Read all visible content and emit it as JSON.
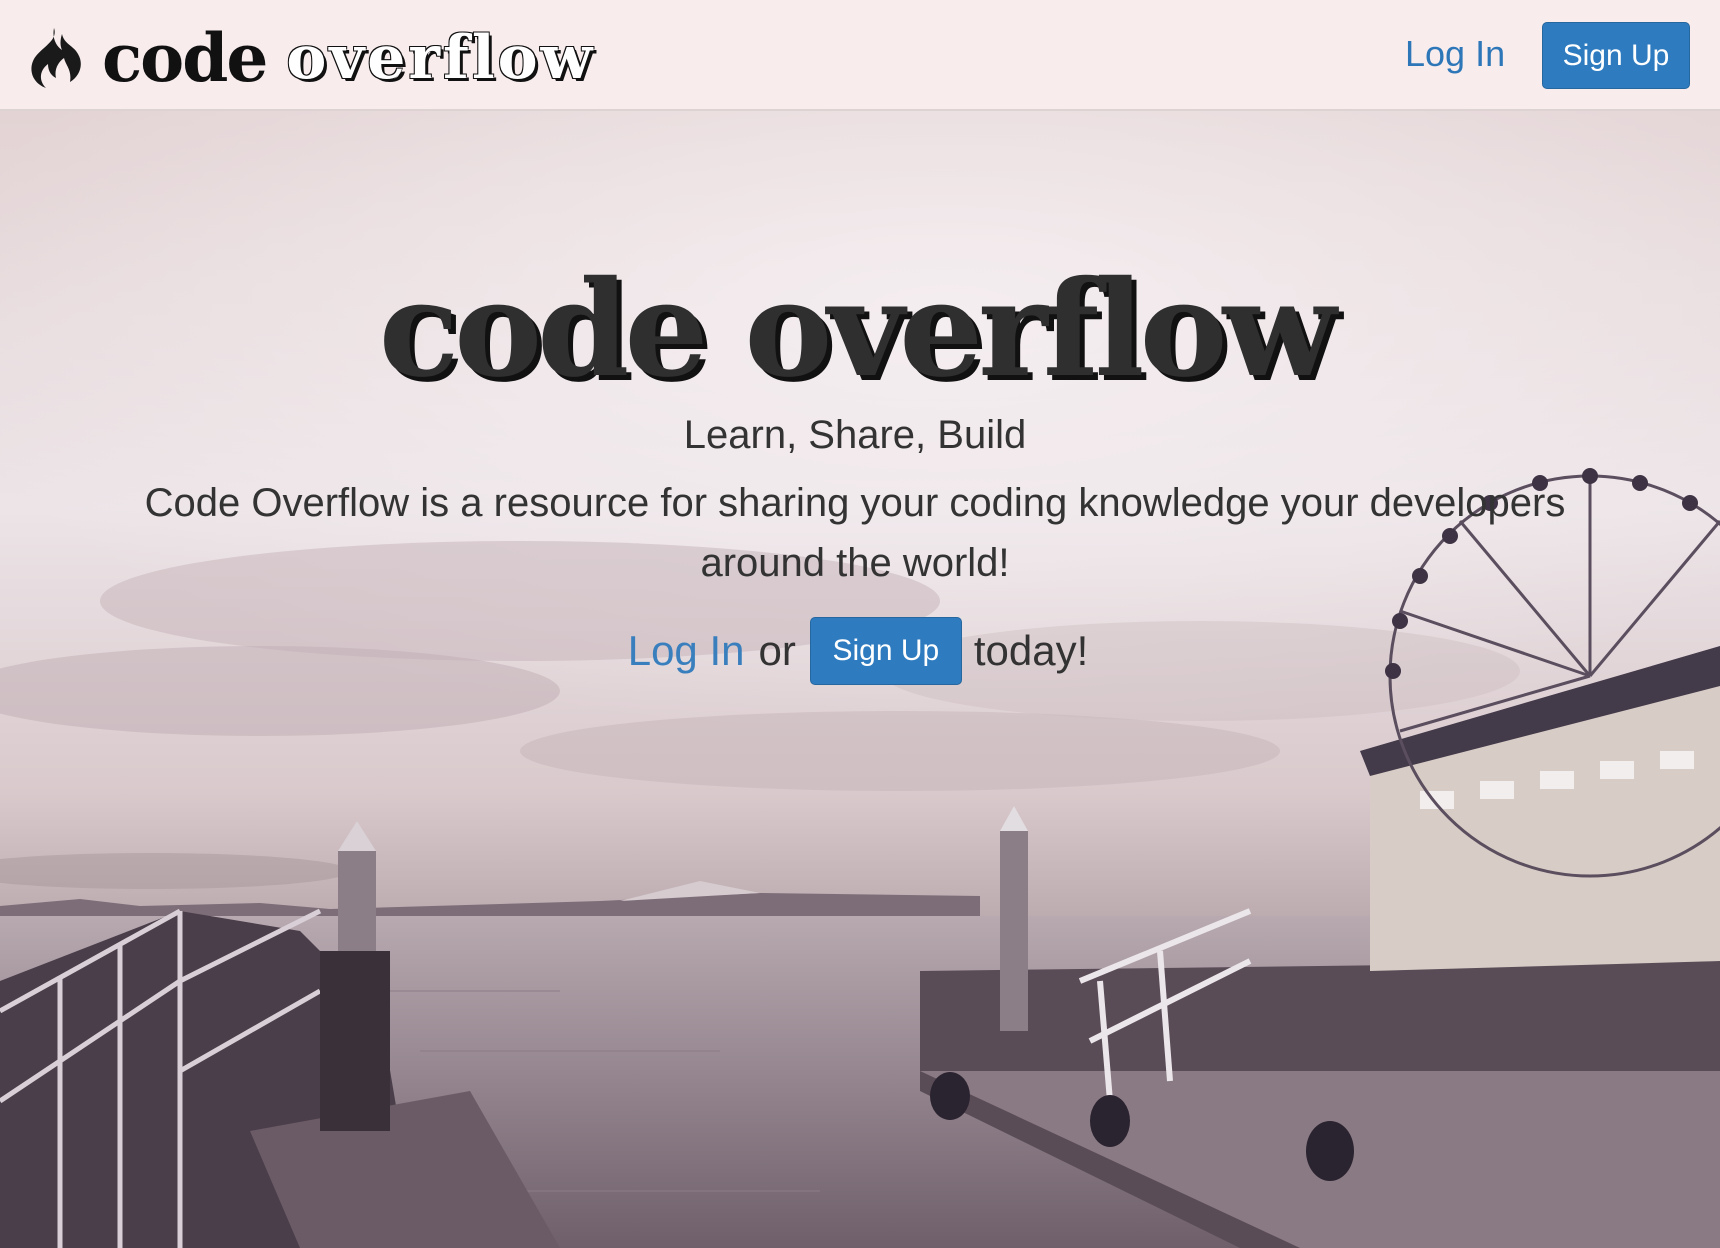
{
  "nav": {
    "brand_word1": "code",
    "brand_word2": "overflow",
    "login_label": "Log In",
    "signup_label": "Sign Up"
  },
  "hero": {
    "title": "code overflow",
    "tagline": "Learn, Share, Build",
    "description": "Code Overflow is a resource for sharing your coding knowledge your developers around the world!",
    "cta_login": "Log In",
    "cta_or": "or",
    "cta_signup": "Sign Up",
    "cta_suffix": "today!"
  },
  "colors": {
    "navbar_bg": "#f8eced",
    "link": "#2d77b8",
    "button": "#2e7bbf"
  },
  "icons": {
    "brand": "flame-icon"
  }
}
